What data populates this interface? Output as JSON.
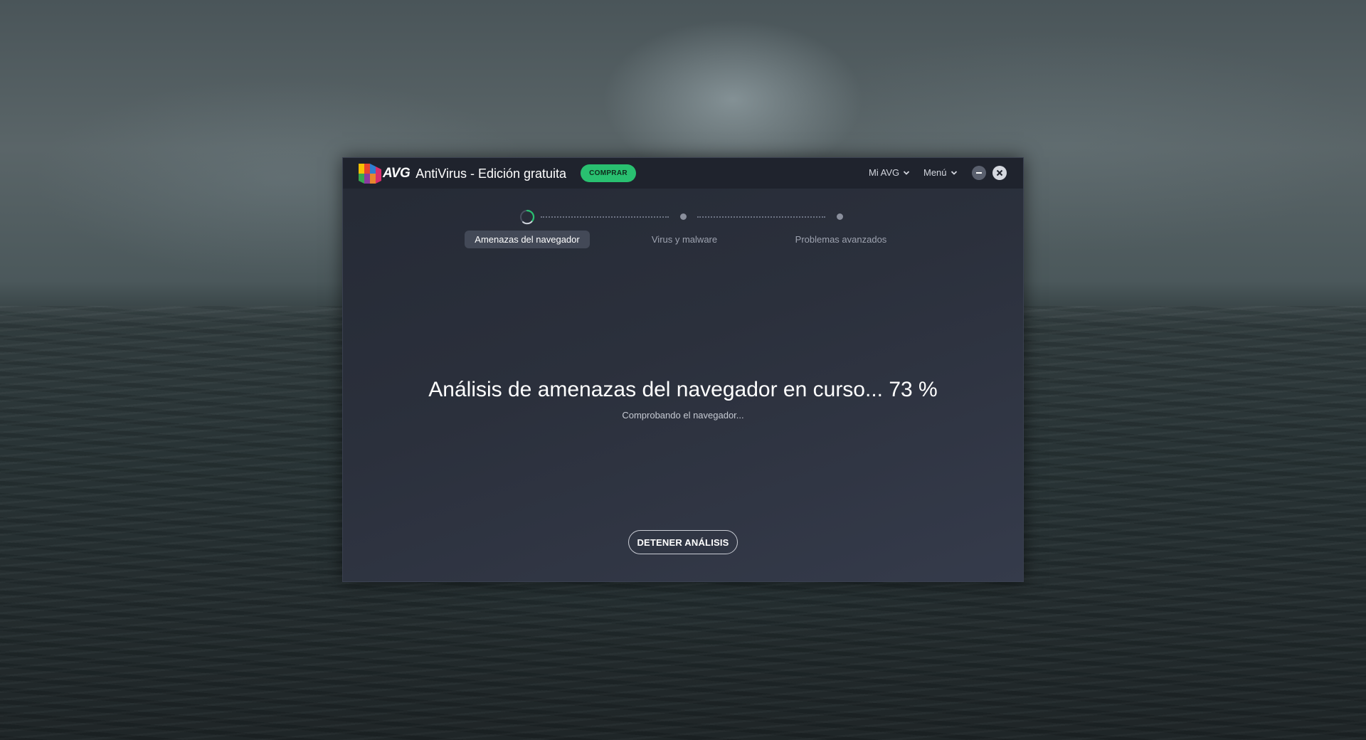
{
  "app": {
    "brand": "AVG",
    "product": "AntiVirus - Edición gratuita",
    "buy_label": "COMPRAR",
    "mi_avg_label": "Mi AVG",
    "menu_label": "Menú",
    "accent_color": "#29c070"
  },
  "stepper": {
    "steps": [
      {
        "label": "Amenazas del navegador",
        "state": "active"
      },
      {
        "label": "Virus y malware",
        "state": "pending"
      },
      {
        "label": "Problemas avanzados",
        "state": "pending"
      }
    ]
  },
  "scan": {
    "title": "Análisis de amenazas del navegador en curso... 73 %",
    "progress_percent": 73,
    "subtitle": "Comprobando el navegador...",
    "stop_label": "DETENER ANÁLISIS"
  },
  "icons": {
    "logo": "avg-logo-icon",
    "spinner": "spinner-icon",
    "chevron": "chevron-down-icon",
    "minimize": "minimize-icon",
    "close": "close-icon"
  }
}
